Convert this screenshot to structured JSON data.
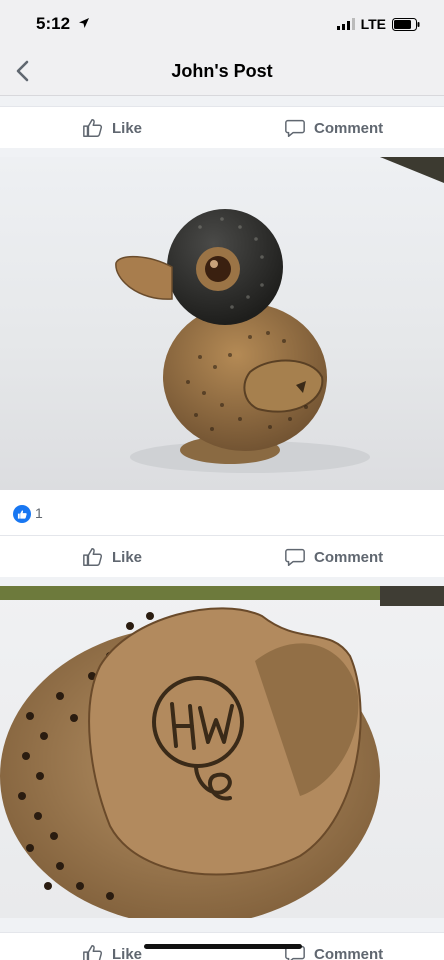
{
  "status": {
    "time": "5:12",
    "network": "LTE"
  },
  "nav": {
    "title": "John's Post"
  },
  "actions": {
    "like_label": "Like",
    "comment_label": "Comment"
  },
  "reactions": {
    "count": "1"
  },
  "colors": {
    "facebook_blue": "#1877f2",
    "action_gray": "#606770"
  },
  "photos": [
    {
      "description_icon": "ceramic-duck-photo"
    },
    {
      "description_icon": "ceramic-duck-underside-photo"
    }
  ]
}
